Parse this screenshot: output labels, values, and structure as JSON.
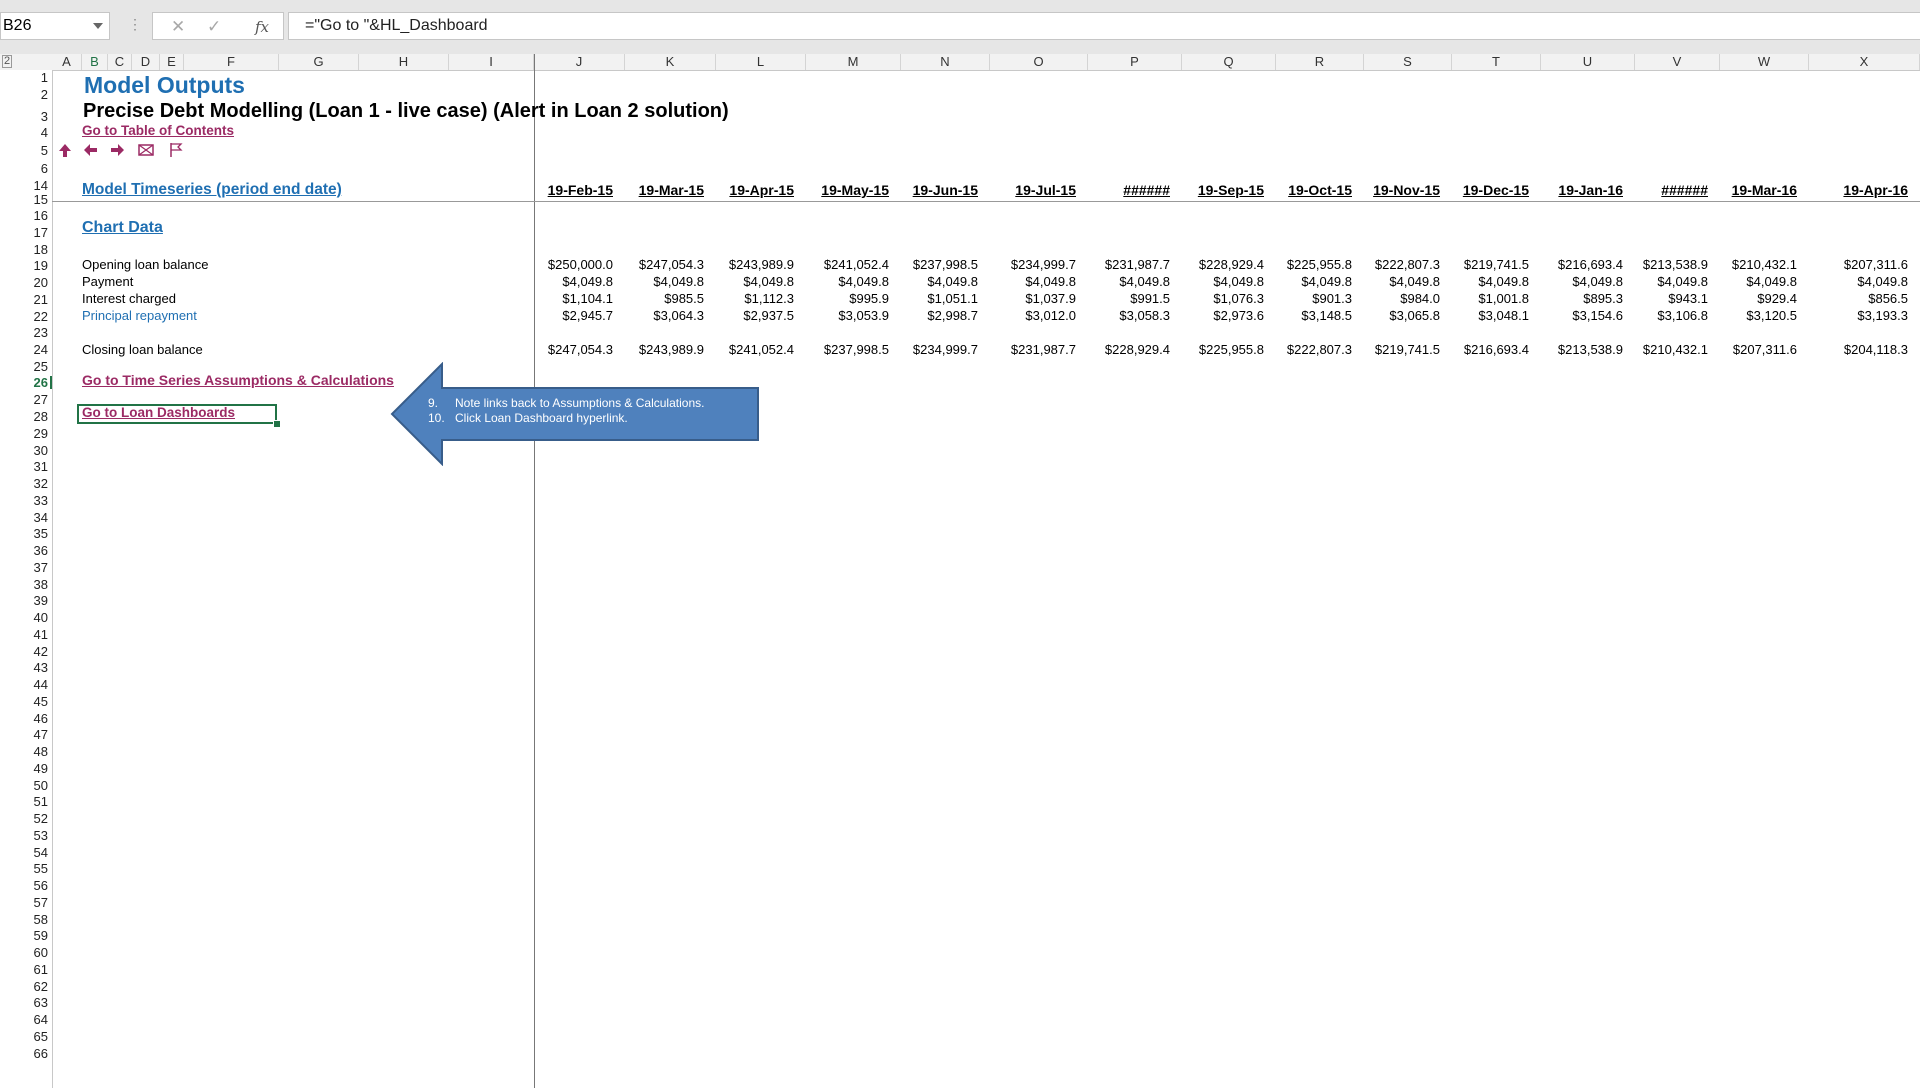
{
  "formula_bar": {
    "name_box": "B26",
    "dots": "⋮",
    "cancel": "✕",
    "enter": "✓",
    "fx": "fx",
    "formula": "=\"Go to \"&HL_Dashboard"
  },
  "outline_level": "2",
  "columns": [
    "A",
    "B",
    "C",
    "D",
    "E",
    "F",
    "G",
    "H",
    "I",
    "J",
    "K",
    "L",
    "M",
    "N",
    "O",
    "P",
    "Q",
    "R",
    "S",
    "T",
    "U",
    "V",
    "W",
    "X"
  ],
  "rows": [
    "1",
    "2",
    "3",
    "4",
    "5",
    "6",
    "14",
    "15",
    "16",
    "17",
    "18",
    "19",
    "20",
    "21",
    "22",
    "23",
    "24",
    "25",
    "26",
    "27",
    "28",
    "29",
    "30",
    "31",
    "32",
    "33",
    "34",
    "35",
    "36",
    "37",
    "38",
    "39",
    "40",
    "41",
    "42",
    "43",
    "44",
    "45",
    "46",
    "47",
    "48",
    "49",
    "50",
    "51",
    "52",
    "53",
    "54",
    "55",
    "56",
    "57",
    "58",
    "59",
    "60",
    "61",
    "62",
    "63",
    "64",
    "65",
    "66"
  ],
  "sheet": {
    "title": "Model Outputs",
    "subtitle": "Precise Debt Modelling (Loan 1 - live case) (Alert in Loan 2 solution)",
    "toc_link": "Go to Table of Contents",
    "nav_icons": [
      "arrow-up-icon",
      "arrow-left-icon",
      "arrow-right-icon",
      "envelope-icon",
      "flag-icon"
    ],
    "timeseries_label": "Model Timeseries (period end date)",
    "dates": [
      "19-Feb-15",
      "19-Mar-15",
      "19-Apr-15",
      "19-May-15",
      "19-Jun-15",
      "19-Jul-15",
      "######",
      "19-Sep-15",
      "19-Oct-15",
      "19-Nov-15",
      "19-Dec-15",
      "19-Jan-16",
      "######",
      "19-Mar-16",
      "19-Apr-16"
    ],
    "chart_data_label": "Chart Data",
    "data_rows": [
      {
        "label": "Opening loan balance",
        "values": [
          "$250,000.0",
          "$247,054.3",
          "$243,989.9",
          "$241,052.4",
          "$237,998.5",
          "$234,999.7",
          "$231,987.7",
          "$228,929.4",
          "$225,955.8",
          "$222,807.3",
          "$219,741.5",
          "$216,693.4",
          "$213,538.9",
          "$210,432.1",
          "$207,311.6"
        ]
      },
      {
        "label": "Payment",
        "values": [
          "$4,049.8",
          "$4,049.8",
          "$4,049.8",
          "$4,049.8",
          "$4,049.8",
          "$4,049.8",
          "$4,049.8",
          "$4,049.8",
          "$4,049.8",
          "$4,049.8",
          "$4,049.8",
          "$4,049.8",
          "$4,049.8",
          "$4,049.8",
          "$4,049.8"
        ]
      },
      {
        "label": "Interest charged",
        "values": [
          "$1,104.1",
          "$985.5",
          "$1,112.3",
          "$995.9",
          "$1,051.1",
          "$1,037.9",
          "$991.5",
          "$1,076.3",
          "$901.3",
          "$984.0",
          "$1,001.8",
          "$895.3",
          "$943.1",
          "$929.4",
          "$856.5"
        ]
      },
      {
        "label": "Principal repayment",
        "values": [
          "$2,945.7",
          "$3,064.3",
          "$2,937.5",
          "$3,053.9",
          "$2,998.7",
          "$3,012.0",
          "$3,058.3",
          "$2,973.6",
          "$3,148.5",
          "$3,065.8",
          "$3,048.1",
          "$3,154.6",
          "$3,106.8",
          "$3,120.5",
          "$3,193.3"
        ]
      },
      {
        "label": "Closing loan balance",
        "values": [
          "$247,054.3",
          "$243,989.9",
          "$241,052.4",
          "$237,998.5",
          "$234,999.7",
          "$231,987.7",
          "$228,929.4",
          "$225,955.8",
          "$222,807.3",
          "$219,741.5",
          "$216,693.4",
          "$213,538.9",
          "$210,432.1",
          "$207,311.6",
          "$204,118.3"
        ]
      }
    ],
    "ts_link": "Go to Time Series Assumptions & Calculations",
    "dashboard_link": "Go to Loan Dashboards"
  },
  "callout": {
    "num1": "9.",
    "line1": "Note links back to Assumptions & Calculations.",
    "num2": "10.",
    "line2": "Click Loan Dashboard hyperlink."
  },
  "colors": {
    "title_blue": "#1f6fb2",
    "link_magenta": "#9b2a64",
    "selection_green": "#217346",
    "callout_blue": "#4f81bd"
  }
}
